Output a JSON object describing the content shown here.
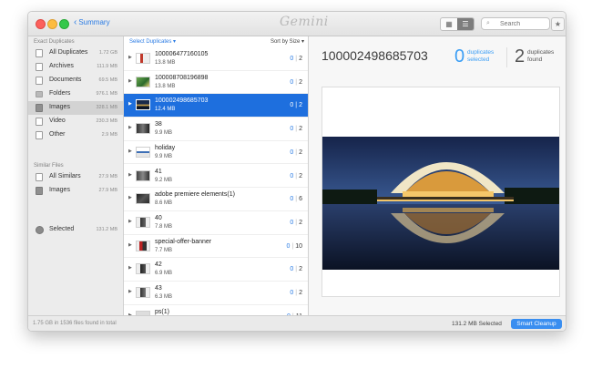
{
  "titlebar": {
    "back_label": "Summary",
    "app_name": "Gemini",
    "search_placeholder": "Search",
    "view_grid_icon": "grid-icon",
    "view_list_icon": "list-icon",
    "favorite_icon": "star-icon"
  },
  "sidebar": {
    "exact_title": "Exact Duplicates",
    "exact_items": [
      {
        "label": "All Duplicates",
        "size": "1.72 GB",
        "icon": "all-duplicates-icon"
      },
      {
        "label": "Archives",
        "size": "111.9 MB",
        "icon": "archive-icon"
      },
      {
        "label": "Documents",
        "size": "69.5 MB",
        "icon": "document-icon"
      },
      {
        "label": "Folders",
        "size": "976.1 MB",
        "icon": "folder-icon"
      },
      {
        "label": "Images",
        "size": "328.1 MB",
        "icon": "image-icon"
      },
      {
        "label": "Video",
        "size": "230.3 MB",
        "icon": "video-icon"
      },
      {
        "label": "Other",
        "size": "2.9 MB",
        "icon": "other-icon"
      }
    ],
    "similar_title": "Similar Files",
    "similar_items": [
      {
        "label": "All Similars",
        "size": "27.9 MB",
        "icon": "all-similars-icon"
      },
      {
        "label": "Images",
        "size": "27.9 MB",
        "icon": "image-icon"
      }
    ],
    "selected_item": {
      "label": "Selected",
      "size": "131.2 MB",
      "icon": "selected-icon"
    }
  },
  "list": {
    "header_left": "Select Duplicates ▾",
    "header_right": "Sort by Size ▾",
    "rows": [
      {
        "name": "100006477160105",
        "size": "13.8 MB",
        "selected_count": "0",
        "found_count": "2"
      },
      {
        "name": "100008708196898",
        "size": "13.8 MB",
        "selected_count": "0",
        "found_count": "2"
      },
      {
        "name": "100002498685703",
        "size": "12.4 MB",
        "selected_count": "0",
        "found_count": "2"
      },
      {
        "name": "38",
        "size": "9.9 MB",
        "selected_count": "0",
        "found_count": "2"
      },
      {
        "name": "holiday",
        "size": "9.9 MB",
        "selected_count": "0",
        "found_count": "2"
      },
      {
        "name": "41",
        "size": "9.2 MB",
        "selected_count": "0",
        "found_count": "2"
      },
      {
        "name": "adobe premiere elements(1)",
        "size": "8.6 MB",
        "selected_count": "0",
        "found_count": "6"
      },
      {
        "name": "40",
        "size": "7.8 MB",
        "selected_count": "0",
        "found_count": "2"
      },
      {
        "name": "special-offer-banner",
        "size": "7.7 MB",
        "selected_count": "0",
        "found_count": "10"
      },
      {
        "name": "42",
        "size": "6.9 MB",
        "selected_count": "0",
        "found_count": "2"
      },
      {
        "name": "43",
        "size": "6.3 MB",
        "selected_count": "0",
        "found_count": "2"
      },
      {
        "name": "ps(1)",
        "size": "",
        "selected_count": "0",
        "found_count": "11"
      }
    ]
  },
  "preview": {
    "title": "100002498685703",
    "selected_num": "0",
    "selected_text_1": "duplicates",
    "selected_text_2": "selected",
    "found_num": "2",
    "found_text_1": "duplicates",
    "found_text_2": "found"
  },
  "footer": {
    "summary": "1.75 GB in 1536 files found in total",
    "selected_size": "131.2 MB Selected",
    "cleanup_label": "Smart Cleanup"
  },
  "colors": {
    "accent": "#2a7be4",
    "selection": "#1e6fde",
    "button": "#3a8ef0"
  }
}
